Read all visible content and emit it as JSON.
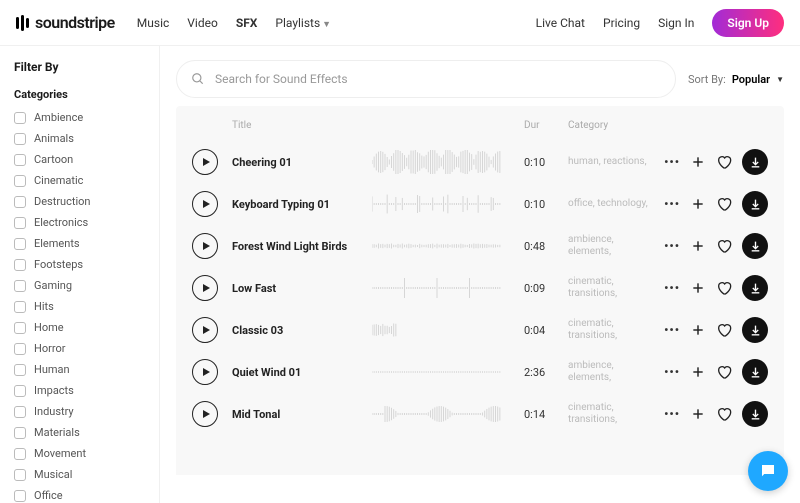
{
  "brand": "soundstripe",
  "nav": {
    "items": [
      "Music",
      "Video",
      "SFX",
      "Playlists"
    ],
    "active": 2
  },
  "header_links": {
    "live_chat": "Live Chat",
    "pricing": "Pricing",
    "sign_in": "Sign In",
    "sign_up": "Sign Up"
  },
  "sidebar": {
    "filter_by": "Filter By",
    "categories_label": "Categories",
    "categories": [
      "Ambience",
      "Animals",
      "Cartoon",
      "Cinematic",
      "Destruction",
      "Electronics",
      "Elements",
      "Footsteps",
      "Gaming",
      "Hits",
      "Home",
      "Horror",
      "Human",
      "Impacts",
      "Industry",
      "Materials",
      "Movement",
      "Musical",
      "Office"
    ]
  },
  "search": {
    "placeholder": "Search for Sound Effects"
  },
  "sort": {
    "label": "Sort By:",
    "value": "Popular"
  },
  "columns": {
    "title": "Title",
    "dur": "Dur",
    "category": "Category"
  },
  "tracks": [
    {
      "title": "Cheering 01",
      "dur": "0:10",
      "cat": "human, reactions,",
      "wave": "dense"
    },
    {
      "title": "Keyboard Typing 01",
      "dur": "0:10",
      "cat": "office, technology,",
      "wave": "sparse"
    },
    {
      "title": "Forest Wind Light Birds",
      "dur": "0:48",
      "cat": "ambience, elements,",
      "wave": "low"
    },
    {
      "title": "Low Fast",
      "dur": "0:09",
      "cat": "cinematic, transitions,",
      "wave": "spikes"
    },
    {
      "title": "Classic 03",
      "dur": "0:04",
      "cat": "cinematic, transitions,",
      "wave": "tiny"
    },
    {
      "title": "Quiet Wind 01",
      "dur": "2:36",
      "cat": "ambience, elements,",
      "wave": "flat"
    },
    {
      "title": "Mid Tonal",
      "dur": "0:14",
      "cat": "cinematic, transitions,",
      "wave": "blobs"
    }
  ]
}
